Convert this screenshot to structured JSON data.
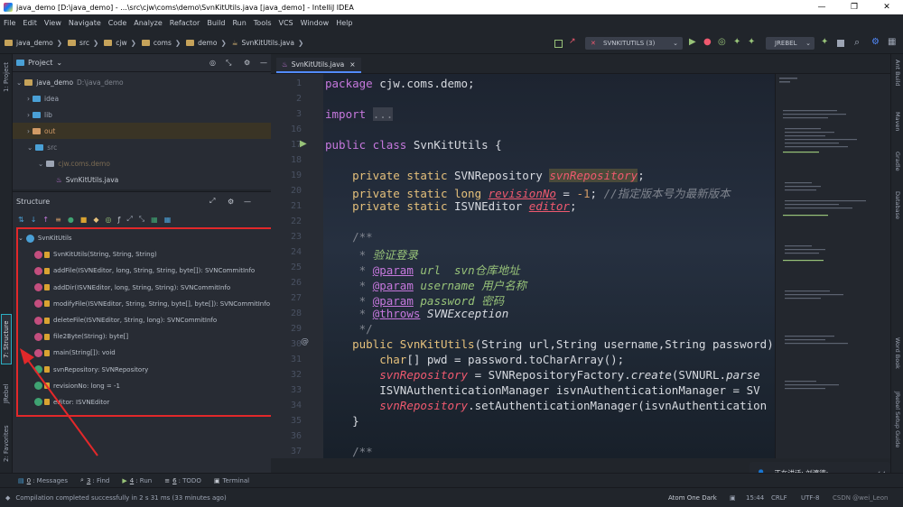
{
  "window": {
    "title": "java_demo [D:\\java_demo] - ...\\src\\cjw\\coms\\demo\\SvnKitUtils.java [java_demo] - IntelliJ IDEA",
    "minimize": "—",
    "maximize": "❐",
    "close": "✕"
  },
  "menu": [
    "File",
    "Edit",
    "View",
    "Navigate",
    "Code",
    "Analyze",
    "Refactor",
    "Build",
    "Run",
    "Tools",
    "VCS",
    "Window",
    "Help"
  ],
  "breadcrumbs": [
    "java_demo",
    "src",
    "cjw",
    "coms",
    "demo",
    "SvnKitUtils.java"
  ],
  "toolbar": {
    "run_config": "SVNKITUTILS (3)",
    "jrebel": "JREBEL"
  },
  "project_panel": {
    "title": "Project",
    "tree": [
      {
        "name": "java_demo",
        "extra": "D:\\java_demo",
        "indent": 0
      },
      {
        "name": "idea",
        "indent": 1
      },
      {
        "name": "lib",
        "indent": 1
      },
      {
        "name": "out",
        "indent": 1
      },
      {
        "name": "src",
        "indent": 1
      },
      {
        "name": "cjw.coms.demo",
        "indent": 2
      },
      {
        "name": "SvnKitUtils.java",
        "indent": 3
      }
    ]
  },
  "structure_panel": {
    "title": "Structure",
    "class_name": "SvnKitUtils",
    "members": [
      {
        "kind": "method",
        "text": "SvnKitUtils(String, String, String)"
      },
      {
        "kind": "method",
        "text": "addFile(ISVNEditor, long, String, String, byte[]): SVNCommitInfo"
      },
      {
        "kind": "method",
        "text": "addDir(ISVNEditor, long, String, String): SVNCommitInfo"
      },
      {
        "kind": "method",
        "text": "modifyFile(ISVNEditor, String, String, byte[], byte[]): SVNCommitInfo"
      },
      {
        "kind": "method",
        "text": "deleteFile(ISVNEditor, String, long): SVNCommitInfo"
      },
      {
        "kind": "method",
        "text": "file2Byte(String): byte[]"
      },
      {
        "kind": "method",
        "text": "main(String[]): void"
      },
      {
        "kind": "field",
        "text": "svnRepository: SVNRepository"
      },
      {
        "kind": "field",
        "text": "revisionNo: long = -1"
      },
      {
        "kind": "field",
        "text": "editor: ISVNEditor"
      }
    ]
  },
  "editor": {
    "tab": "SvnKitUtils.java",
    "line_numbers": [
      "1",
      "2",
      "3",
      "16",
      "17",
      "18",
      "19",
      "20",
      "21",
      "22",
      "23",
      "24",
      "25",
      "26",
      "27",
      "28",
      "29",
      "30",
      "31",
      "32",
      "33",
      "34",
      "35",
      "36",
      "37"
    ]
  },
  "left_tabs": [
    "1: Project",
    "7: Structure",
    "JRebel",
    "2: Favorites"
  ],
  "right_tabs": [
    "Ant Build",
    "Maven",
    "Gradle",
    "Database",
    "Word Book",
    "JRebel Setup Guide"
  ],
  "bottom_tabs": [
    {
      "key": "0",
      "label": ": Messages"
    },
    {
      "key": "3",
      "label": ": Find"
    },
    {
      "key": "4",
      "label": ": Run"
    },
    {
      "key": "6",
      "label": ": TODO"
    },
    {
      "key": "",
      "label": "Terminal"
    }
  ],
  "status": {
    "message": "Compilation completed successfully in 2 s 31 ms (33 minutes ago)",
    "theme": "Atom One Dark",
    "position": "15:44",
    "line_sep": "CRLF",
    "encoding": "UTF-8",
    "watermark": "CSDN @wei_Leon"
  },
  "notification": "正在讲话: 刘濂德;"
}
